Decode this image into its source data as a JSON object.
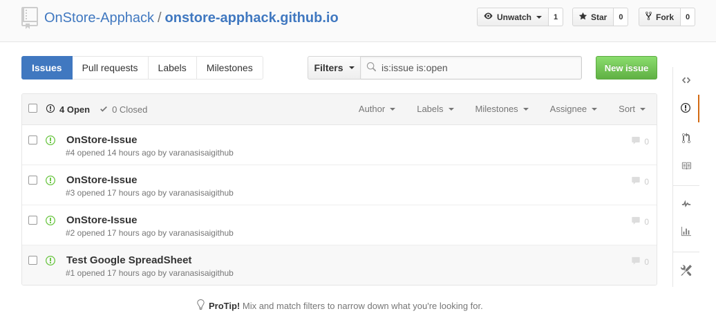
{
  "repo": {
    "owner": "OnStore-Apphack",
    "separator": "/",
    "name": "onstore-apphack.github.io"
  },
  "actions": {
    "watch": {
      "label": "Unwatch",
      "count": "1"
    },
    "star": {
      "label": "Star",
      "count": "0"
    },
    "fork": {
      "label": "Fork",
      "count": "0"
    }
  },
  "subnav": {
    "tabs": [
      {
        "label": "Issues"
      },
      {
        "label": "Pull requests"
      },
      {
        "label": "Labels"
      },
      {
        "label": "Milestones"
      }
    ]
  },
  "filters": {
    "button_label": "Filters",
    "query": "is:issue is:open"
  },
  "new_issue_label": "New issue",
  "header": {
    "open_label": "4 Open",
    "closed_label": "0 Closed",
    "sorts": [
      "Author",
      "Labels",
      "Milestones",
      "Assignee",
      "Sort"
    ]
  },
  "issues": [
    {
      "title": "OnStore-Issue",
      "meta": "#4 opened 14 hours ago by varanasisaigithub",
      "comments": "0"
    },
    {
      "title": "OnStore-Issue",
      "meta": "#3 opened 17 hours ago by varanasisaigithub",
      "comments": "0"
    },
    {
      "title": "OnStore-Issue",
      "meta": "#2 opened 17 hours ago by varanasisaigithub",
      "comments": "0"
    },
    {
      "title": "Test Google SpreadSheet",
      "meta": "#1 opened 17 hours ago by varanasisaigithub",
      "comments": "0"
    }
  ],
  "protip": {
    "label": "ProTip!",
    "text": " Mix and match filters to narrow down what you're looking for."
  },
  "sidebar": {
    "icons": [
      "code-icon",
      "issue-opened-icon",
      "git-pull-request-icon",
      "book-icon",
      "pulse-icon",
      "graph-icon",
      "tools-icon"
    ],
    "selected": "issue-opened-icon"
  },
  "colors": {
    "link": "#4078c0",
    "open_green": "#6cc644",
    "new_issue_green": "#60b044",
    "selected_tab": "#4078c0",
    "sidebar_selected": "#d26911"
  }
}
